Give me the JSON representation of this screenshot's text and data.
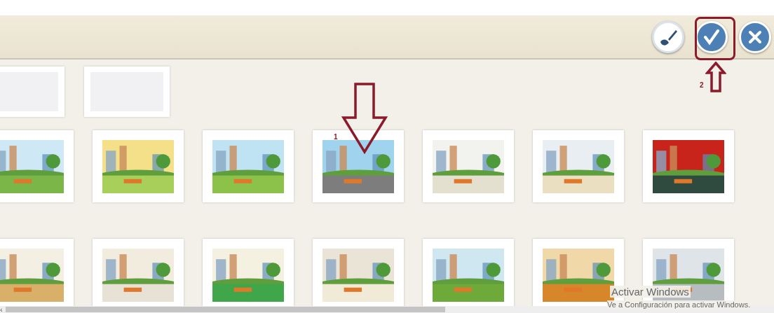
{
  "toolbar": {
    "buttons": [
      {
        "kind": "brush"
      },
      {
        "kind": "confirm"
      },
      {
        "kind": "close"
      }
    ]
  },
  "slots": [
    {
      "kind": "empty"
    },
    {
      "kind": "empty"
    }
  ],
  "annotations": [
    {
      "label": "1"
    },
    {
      "label": "2"
    }
  ],
  "os_notice": {
    "title": "Activar Windows",
    "text": "Ve a Configuración para activar Windows."
  },
  "scrollbar": {
    "arrow": "‹"
  }
}
